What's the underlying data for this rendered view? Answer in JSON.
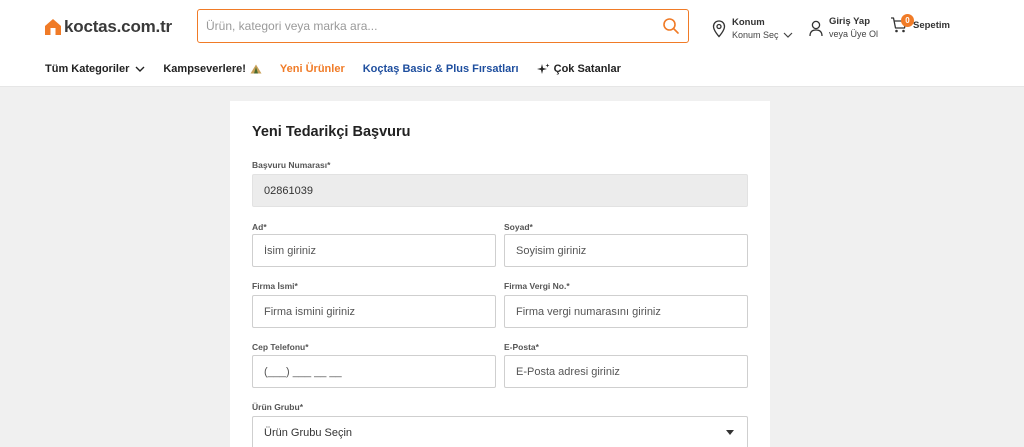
{
  "header": {
    "logo_text": "koctas.com.tr",
    "search_placeholder": "Ürün, kategori veya marka ara...",
    "location": {
      "title": "Konum",
      "subtitle": "Konum Seç"
    },
    "login": {
      "title": "Giriş Yap",
      "subtitle": "veya Üye Ol"
    },
    "cart": {
      "label": "Sepetim",
      "count": "0"
    }
  },
  "nav": {
    "items": [
      {
        "label": "Tüm Kategoriler"
      },
      {
        "label": "Kampseverlere!"
      },
      {
        "label": "Yeni Ürünler"
      },
      {
        "label": "Koçtaş Basic & Plus Fırsatları"
      },
      {
        "label": "Çok Satanlar"
      }
    ]
  },
  "form": {
    "title": "Yeni Tedarikçi Başvuru",
    "application_number": {
      "label": "Başvuru Numarası*",
      "value": "02861039"
    },
    "first_name": {
      "label": "Ad*",
      "placeholder": "İsim giriniz"
    },
    "last_name": {
      "label": "Soyad*",
      "placeholder": "Soyisim giriniz"
    },
    "company_name": {
      "label": "Firma İsmi*",
      "placeholder": "Firma ismini giriniz"
    },
    "tax_number": {
      "label": "Firma Vergi No.*",
      "placeholder": "Firma vergi numarasını giriniz"
    },
    "mobile_phone": {
      "label": "Cep Telefonu*",
      "placeholder": "(___) ___ __ __"
    },
    "email": {
      "label": "E-Posta*",
      "placeholder": "E-Posta adresi giriniz"
    },
    "product_group": {
      "label": "Ürün Grubu*",
      "value": "Ürün Grubu Seçin"
    }
  },
  "colors": {
    "accent": "#f07b27",
    "link_blue": "#1e4e9e",
    "page_bg": "#f0f0f0"
  }
}
